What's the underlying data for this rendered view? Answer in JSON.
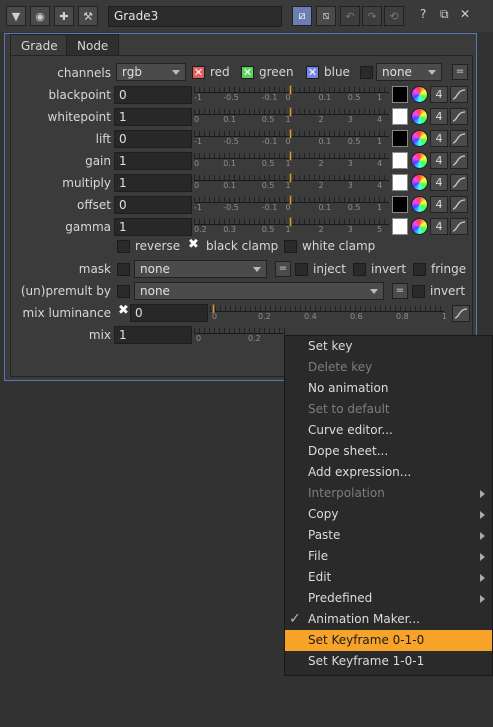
{
  "toolbar": {
    "node_name": "Grade3",
    "help": "?",
    "float": "⧉",
    "close": "✕"
  },
  "tabs": [
    "Grade",
    "Node"
  ],
  "channels": {
    "label": "channels",
    "value": "rgb",
    "red": "red",
    "green": "green",
    "blue": "blue",
    "extra": "none",
    "eq": "="
  },
  "params": [
    {
      "label": "blackpoint",
      "value": "0",
      "swatch": "black",
      "ticks": [
        "-1",
        "-0.5",
        "-0.1",
        "0",
        "0.1",
        "0.5",
        "1"
      ],
      "num": "4"
    },
    {
      "label": "whitepoint",
      "value": "1",
      "swatch": "white",
      "ticks": [
        "0",
        "0.1",
        "0.5",
        "1",
        "2",
        "3",
        "4"
      ],
      "num": "4"
    },
    {
      "label": "lift",
      "value": "0",
      "swatch": "black",
      "ticks": [
        "-1",
        "-0.5",
        "-0.1",
        "0",
        "0.1",
        "0.5",
        "1"
      ],
      "num": "4"
    },
    {
      "label": "gain",
      "value": "1",
      "swatch": "white",
      "ticks": [
        "0",
        "0.1",
        "0.5",
        "1",
        "2",
        "3",
        "4"
      ],
      "num": "4"
    },
    {
      "label": "multiply",
      "value": "1",
      "swatch": "white",
      "ticks": [
        "0",
        "0.1",
        "0.5",
        "1",
        "2",
        "3",
        "4"
      ],
      "num": "4"
    },
    {
      "label": "offset",
      "value": "0",
      "swatch": "black",
      "ticks": [
        "-1",
        "-0.5",
        "-0.1",
        "0",
        "0.1",
        "0.5",
        "1"
      ],
      "num": "4"
    },
    {
      "label": "gamma",
      "value": "1",
      "swatch": "white",
      "ticks": [
        "0.2",
        "0.3",
        "0.5",
        "1",
        "2",
        "3",
        "5"
      ],
      "num": "4"
    }
  ],
  "options": {
    "reverse": "reverse",
    "black_clamp": "black clamp",
    "white_clamp": "white clamp"
  },
  "mask": {
    "label": "mask",
    "value": "none",
    "eq": "=",
    "inject": "inject",
    "invert": "invert",
    "fringe": "fringe"
  },
  "premult": {
    "label": "(un)premult by",
    "value": "none",
    "eq": "=",
    "invert": "invert"
  },
  "mix_luminance": {
    "label": "mix luminance",
    "value": "0",
    "ticks": [
      "0",
      "0.2",
      "0.4",
      "0.6",
      "0.8",
      "1"
    ]
  },
  "mix": {
    "label": "mix",
    "value": "1",
    "ticks": [
      "0",
      "0.2"
    ]
  },
  "menu": [
    {
      "label": "Set key",
      "disabled": false,
      "sub": false
    },
    {
      "label": "Delete key",
      "disabled": true,
      "sub": false
    },
    {
      "label": "No animation",
      "disabled": false,
      "sub": false
    },
    {
      "label": "Set to default",
      "disabled": true,
      "sub": false
    },
    {
      "label": "Curve editor...",
      "disabled": false,
      "sub": false
    },
    {
      "label": "Dope sheet...",
      "disabled": false,
      "sub": false
    },
    {
      "label": "Add expression...",
      "disabled": false,
      "sub": false
    },
    {
      "label": "Interpolation",
      "disabled": true,
      "sub": true
    },
    {
      "label": "Copy",
      "disabled": false,
      "sub": true
    },
    {
      "label": "Paste",
      "disabled": false,
      "sub": true
    },
    {
      "label": "File",
      "disabled": false,
      "sub": true
    },
    {
      "label": "Edit",
      "disabled": false,
      "sub": true
    },
    {
      "label": "Predefined",
      "disabled": false,
      "sub": true
    },
    {
      "label": "Animation Maker...",
      "disabled": false,
      "sub": false,
      "checked": true
    },
    {
      "label": "Set Keyframe 0-1-0",
      "disabled": false,
      "sub": false,
      "highlighted": true
    },
    {
      "label": "Set Keyframe 1-0-1",
      "disabled": false,
      "sub": false
    }
  ],
  "colors": {
    "accent": "#f7a329",
    "panel_border": "#5b77b3",
    "knob": "#c9a04f"
  }
}
